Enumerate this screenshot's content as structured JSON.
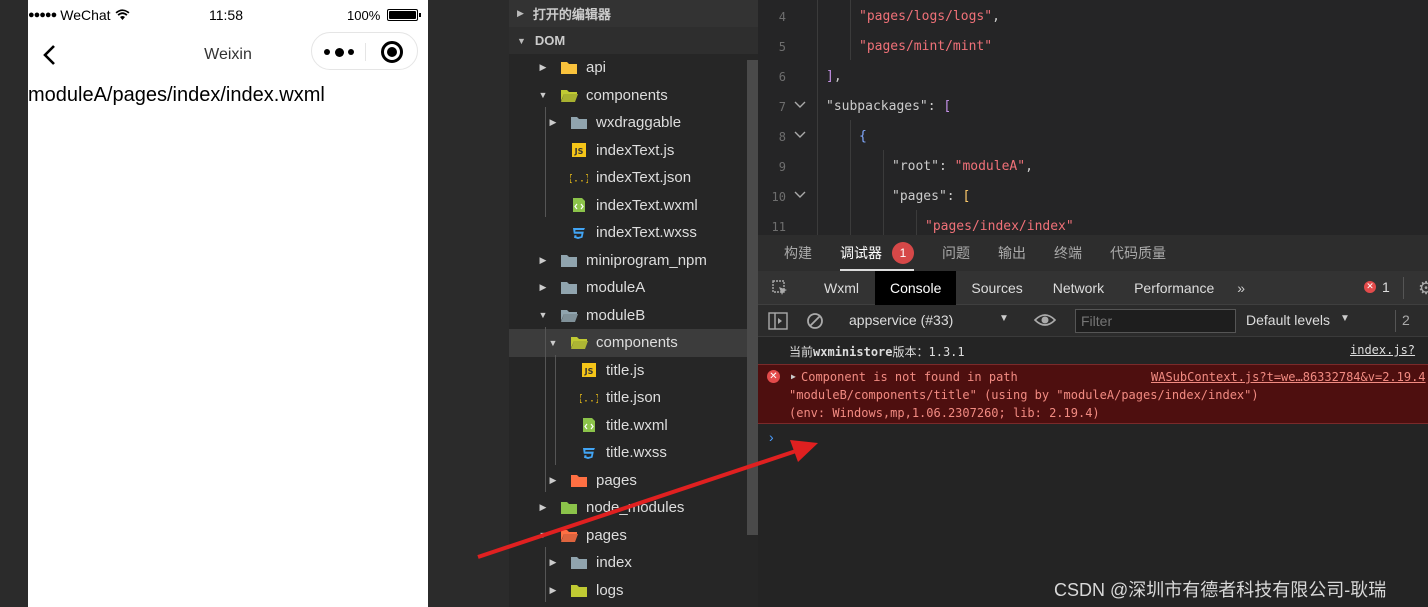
{
  "simulator": {
    "status_bar": {
      "carrier": "WeChat",
      "time": "11:58",
      "battery": "100%"
    },
    "nav_title": "Weixin",
    "page_text": "moduleA/pages/index/index.wxml"
  },
  "explorer": {
    "sections": [
      {
        "label": "打开的编辑器",
        "expanded": false
      },
      {
        "label": "DOM",
        "expanded": true
      }
    ],
    "items": [
      {
        "label": "api",
        "depth": 0,
        "expanded": false,
        "icon": "folder-api-icon"
      },
      {
        "label": "components",
        "depth": 0,
        "expanded": true,
        "icon": "folder-components-icon"
      },
      {
        "label": "wxdraggable",
        "depth": 1,
        "expanded": false,
        "icon": "folder-icon"
      },
      {
        "label": "indexText.js",
        "depth": 1,
        "icon": "js-file-icon"
      },
      {
        "label": "indexText.json",
        "depth": 1,
        "icon": "json-file-icon"
      },
      {
        "label": "indexText.wxml",
        "depth": 1,
        "icon": "wxml-file-icon"
      },
      {
        "label": "indexText.wxss",
        "depth": 1,
        "icon": "wxss-file-icon"
      },
      {
        "label": "miniprogram_npm",
        "depth": 0,
        "expanded": false,
        "icon": "folder-icon"
      },
      {
        "label": "moduleA",
        "depth": 0,
        "expanded": false,
        "icon": "folder-icon"
      },
      {
        "label": "moduleB",
        "depth": 0,
        "expanded": true,
        "icon": "folder-icon"
      },
      {
        "label": "components",
        "depth": 1,
        "expanded": true,
        "icon": "folder-components-icon",
        "selected": true
      },
      {
        "label": "title.js",
        "depth": 2,
        "icon": "js-file-icon"
      },
      {
        "label": "title.json",
        "depth": 2,
        "icon": "json-file-icon"
      },
      {
        "label": "title.wxml",
        "depth": 2,
        "icon": "wxml-file-icon"
      },
      {
        "label": "title.wxss",
        "depth": 2,
        "icon": "wxss-file-icon"
      },
      {
        "label": "pages",
        "depth": 1,
        "expanded": false,
        "icon": "folder-pages-icon"
      },
      {
        "label": "node_modules",
        "depth": 0,
        "expanded": false,
        "icon": "folder-node-icon"
      },
      {
        "label": "pages",
        "depth": 0,
        "expanded": true,
        "icon": "folder-pages-icon"
      },
      {
        "label": "index",
        "depth": 1,
        "expanded": false,
        "icon": "folder-icon"
      },
      {
        "label": "logs",
        "depth": 1,
        "expanded": false,
        "icon": "folder-logs-icon"
      }
    ]
  },
  "editor": {
    "lines": [
      {
        "num": "4",
        "fold": false,
        "indent": 2,
        "tokens": [
          [
            "s",
            "\"pages/logs/logs\""
          ],
          [
            "p",
            ","
          ]
        ]
      },
      {
        "num": "5",
        "fold": false,
        "indent": 2,
        "tokens": [
          [
            "s",
            "\"pages/mint/mint\""
          ]
        ]
      },
      {
        "num": "6",
        "fold": false,
        "indent": 1,
        "tokens": [
          [
            "m",
            "]"
          ],
          [
            "p",
            ","
          ]
        ]
      },
      {
        "num": "7",
        "fold": true,
        "indent": 1,
        "tokens": [
          [
            "p",
            "\"subpackages\": "
          ],
          [
            "m",
            "["
          ]
        ]
      },
      {
        "num": "8",
        "fold": true,
        "indent": 2,
        "tokens": [
          [
            "k",
            "{"
          ]
        ]
      },
      {
        "num": "9",
        "fold": false,
        "indent": 3,
        "tokens": [
          [
            "p",
            "\"root\": "
          ],
          [
            "s",
            "\"moduleA\""
          ],
          [
            "p",
            ","
          ]
        ]
      },
      {
        "num": "10",
        "fold": true,
        "indent": 3,
        "tokens": [
          [
            "p",
            "\"pages\": "
          ],
          [
            "b",
            "["
          ]
        ]
      },
      {
        "num": "11",
        "fold": false,
        "indent": 4,
        "tokens": [
          [
            "s",
            "\"pages/index/index\""
          ]
        ]
      }
    ]
  },
  "devtools": {
    "panel_tabs": [
      "构建",
      "调试器",
      "问题",
      "输出",
      "终端",
      "代码质量"
    ],
    "active_panel": 1,
    "panel_badge": "1",
    "tabs": [
      "Wxml",
      "Console",
      "Sources",
      "Network",
      "Performance"
    ],
    "active_tab": 1,
    "overflow_label": "»",
    "error_count": "1",
    "toolbar": {
      "context": "appservice (#33)",
      "filter_placeholder": "Filter",
      "levels": "Default levels",
      "issues_count": "2"
    },
    "logs": {
      "info": {
        "prefix": "当前",
        "name": "wxministore",
        "suffix": "版本：1.3.1",
        "source": "index.js?"
      },
      "error": {
        "line1": "Component is not found in path",
        "line2": "\"moduleB/components/title\" (using by \"moduleA/pages/index/index\")",
        "line3": "(env: Windows,mp,1.06.2307260; lib: 2.19.4)",
        "source": "WASubContext.js?t=we…86332784&v=2.19.4"
      }
    },
    "prompt": "›"
  },
  "annotation": {
    "color": "#e02020"
  },
  "watermark": "CSDN @深圳市有德者科技有限公司-耿瑞"
}
